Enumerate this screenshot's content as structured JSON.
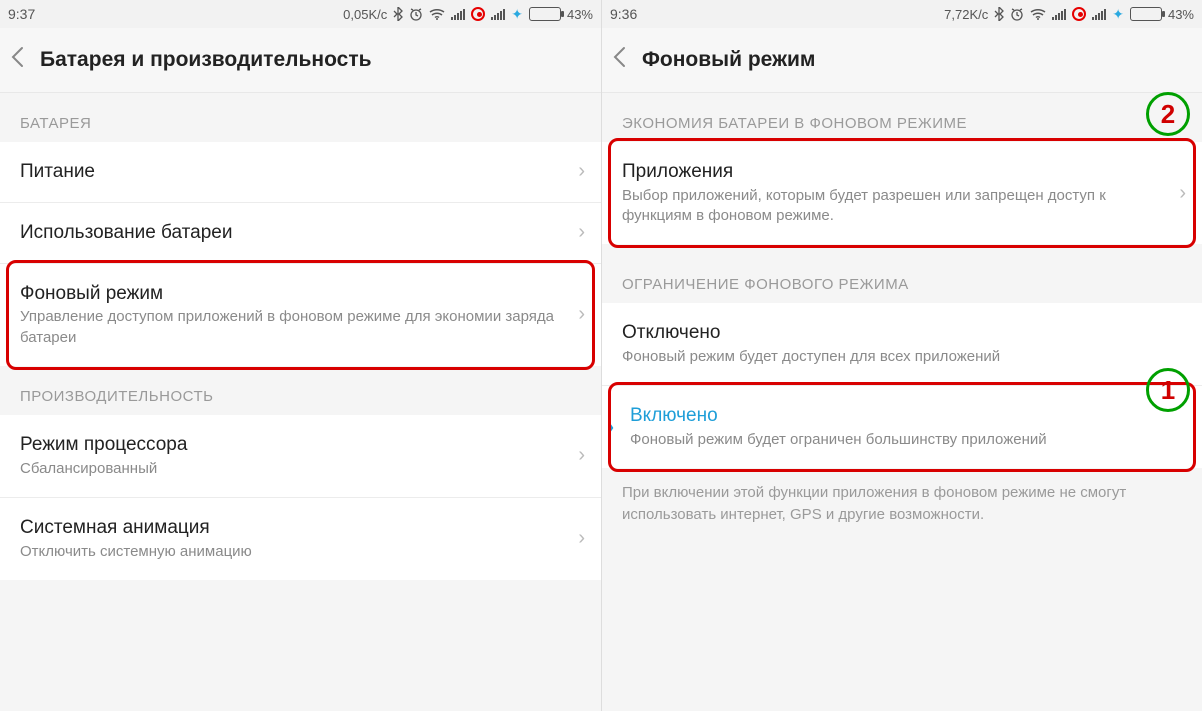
{
  "left": {
    "status": {
      "time": "9:37",
      "speed": "0,05K/c",
      "battery_pct": "43%"
    },
    "title": "Батарея и производительность",
    "sections": {
      "battery_header": "БАТАРЕЯ",
      "perf_header": "ПРОИЗВОДИТЕЛЬНОСТЬ"
    },
    "rows": {
      "power": {
        "title": "Питание"
      },
      "usage": {
        "title": "Использование батареи"
      },
      "bgmode": {
        "title": "Фоновый режим",
        "sub": "Управление доступом приложений в фоновом режиме для экономии заряда батареи"
      },
      "cpu": {
        "title": "Режим процессора",
        "sub": "Сбалансированный"
      },
      "anim": {
        "title": "Системная анимация",
        "sub": "Отключить системную анимацию"
      }
    }
  },
  "right": {
    "status": {
      "time": "9:36",
      "speed": "7,72K/c",
      "battery_pct": "43%"
    },
    "title": "Фоновый режим",
    "sections": {
      "econ_header": "ЭКОНОМИЯ БАТАРЕИ В ФОНОВОМ РЕЖИМЕ",
      "limit_header": "ОГРАНИЧЕНИЕ ФОНОВОГО РЕЖИМА"
    },
    "rows": {
      "apps": {
        "title": "Приложения",
        "sub": "Выбор приложений, которым будет разрешен или запрещен доступ к функциям в фоновом режиме."
      },
      "off": {
        "title": "Отключено",
        "sub": "Фоновый режим будет доступен для всех приложений"
      },
      "on": {
        "title": "Включено",
        "sub": "Фоновый режим будет ограничен большинству приложений"
      }
    },
    "note": "При включении этой функции приложения в фоновом режиме не смогут использовать интернет, GPS и другие возможности.",
    "badges": {
      "one": "1",
      "two": "2"
    }
  }
}
